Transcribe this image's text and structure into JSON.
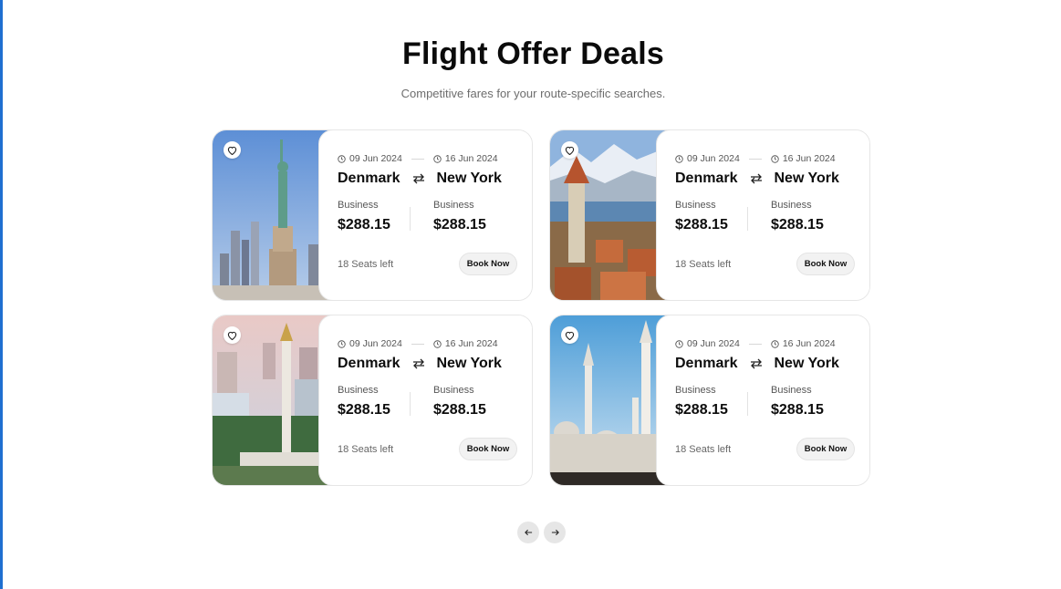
{
  "header": {
    "title": "Flight Offer Deals",
    "subtitle": "Competitive fares for your route-specific searches."
  },
  "cards": [
    {
      "photo": "statue-of-liberty",
      "depart_date": "09 Jun 2024",
      "return_date": "16 Jun 2024",
      "origin": "Denmark",
      "destination": "New York",
      "fare1": {
        "class": "Business",
        "price": "$288.15"
      },
      "fare2": {
        "class": "Business",
        "price": "$288.15"
      },
      "seats": "18 Seats left",
      "book_label": "Book Now"
    },
    {
      "photo": "swiss-alps-town",
      "depart_date": "09 Jun 2024",
      "return_date": "16 Jun 2024",
      "origin": "Denmark",
      "destination": "New York",
      "fare1": {
        "class": "Business",
        "price": "$288.15"
      },
      "fare2": {
        "class": "Business",
        "price": "$288.15"
      },
      "seats": "18 Seats left",
      "book_label": "Book Now"
    },
    {
      "photo": "jakarta-monument",
      "depart_date": "09 Jun 2024",
      "return_date": "16 Jun 2024",
      "origin": "Denmark",
      "destination": "New York",
      "fare1": {
        "class": "Business",
        "price": "$288.15"
      },
      "fare2": {
        "class": "Business",
        "price": "$288.15"
      },
      "seats": "18 Seats left",
      "book_label": "Book Now"
    },
    {
      "photo": "mosque-minarets",
      "depart_date": "09 Jun 2024",
      "return_date": "16 Jun 2024",
      "origin": "Denmark",
      "destination": "New York",
      "fare1": {
        "class": "Business",
        "price": "$288.15"
      },
      "fare2": {
        "class": "Business",
        "price": "$288.15"
      },
      "seats": "18 Seats left",
      "book_label": "Book Now"
    }
  ],
  "pagination": {
    "prev_icon": "arrow-left-icon",
    "next_icon": "arrow-right-icon"
  },
  "colors": {
    "accent_edge": "#1f6fd0",
    "button_bg": "#f2f2f2"
  }
}
